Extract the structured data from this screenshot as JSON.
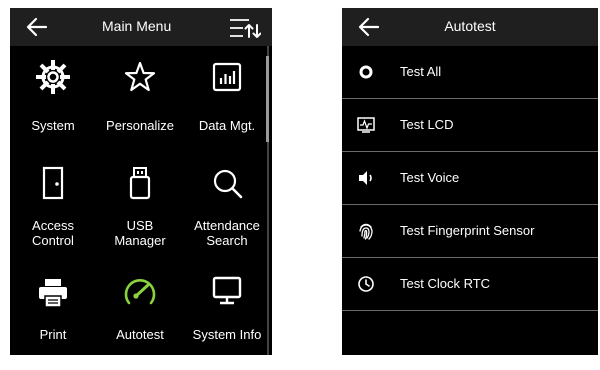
{
  "main_menu": {
    "title": "Main Menu",
    "items": [
      {
        "label": "System",
        "icon": "gear-icon"
      },
      {
        "label": "Personalize",
        "icon": "star-icon"
      },
      {
        "label": "Data Mgt.",
        "icon": "bar-chart-icon"
      },
      {
        "label": "Access\nControl",
        "icon": "door-icon"
      },
      {
        "label": "USB\nManager",
        "icon": "usb-drive-icon"
      },
      {
        "label": "Attendance\nSearch",
        "icon": "magnifier-icon"
      },
      {
        "label": "Print",
        "icon": "printer-icon"
      },
      {
        "label": "Autotest",
        "icon": "gauge-icon"
      },
      {
        "label": "System Info",
        "icon": "monitor-icon"
      }
    ]
  },
  "autotest": {
    "title": "Autotest",
    "items": [
      {
        "label": "Test All",
        "icon": "circle-icon"
      },
      {
        "label": "Test LCD",
        "icon": "lcd-icon"
      },
      {
        "label": "Test Voice",
        "icon": "speaker-icon"
      },
      {
        "label": "Test Fingerprint Sensor",
        "icon": "fingerprint-icon"
      },
      {
        "label": "Test Clock RTC",
        "icon": "clock-icon"
      }
    ]
  },
  "colors": {
    "screen_bg": "#000000",
    "titlebar_bg": "#1f1f1f",
    "text": "#ffffff",
    "autotest_accent": "#8cd23c",
    "divider": "#6a6a6a"
  }
}
